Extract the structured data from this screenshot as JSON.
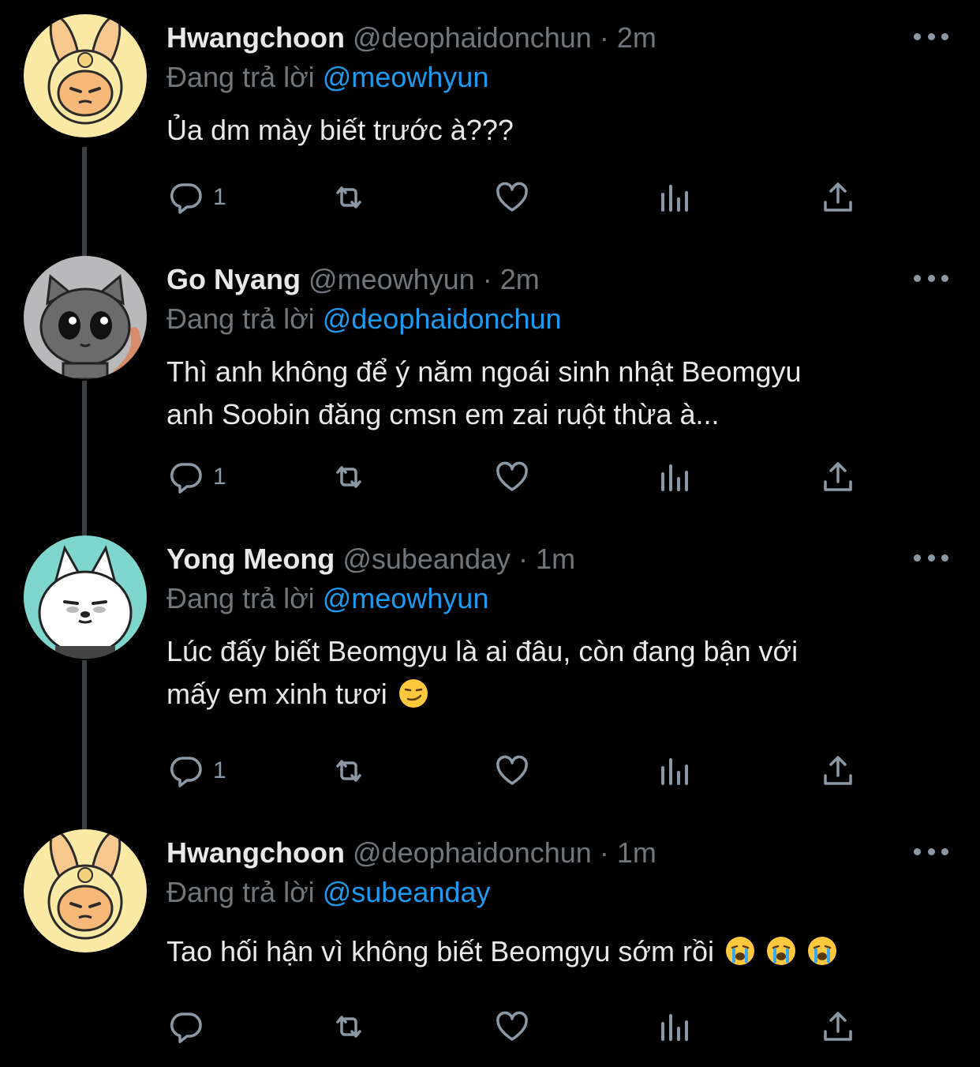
{
  "reply_prefix": "Đang trả lời",
  "tweets": [
    {
      "display_name": "Hwangchoon",
      "handle": "@deophaidonchun",
      "time": "2m",
      "reply_to": "@meowhyun",
      "text": "Ủa dm mày biết trước à???",
      "reply_count": "1",
      "avatar": "bunny-avatar"
    },
    {
      "display_name": "Go Nyang",
      "handle": "@meowhyun",
      "time": "2m",
      "reply_to": "@deophaidonchun",
      "text_lines": [
        "Thì anh không để ý năm ngoái sinh nhật Beomgyu",
        "anh Soobin đăng cmsn em zai ruột thừa à..."
      ],
      "reply_count": "1",
      "avatar": "cat-avatar"
    },
    {
      "display_name": "Yong Meong",
      "handle": "@subeanday",
      "time": "1m",
      "reply_to": "@meowhyun",
      "text_lines": [
        "Lúc đấy biết Beomgyu là ai đâu, còn đang bận với",
        "mấy em xinh tươi"
      ],
      "emoji": "smirk-emoji",
      "reply_count": "1",
      "avatar": "dog-avatar"
    },
    {
      "display_name": "Hwangchoon",
      "handle": "@deophaidonchun",
      "time": "1m",
      "reply_to": "@subeanday",
      "text": "Tao hối hận vì không biết Beomgyu sớm rồi",
      "emoji": "crying-emoji",
      "reply_count": "",
      "avatar": "bunny-avatar"
    }
  ],
  "colors": {
    "background": "#000000",
    "accent": "#1d9bf0",
    "secondary": "#71767b",
    "thread_line": "#3a3f44"
  },
  "icons": [
    "reply-icon",
    "retweet-icon",
    "like-icon",
    "analytics-icon",
    "share-icon",
    "more-icon"
  ]
}
